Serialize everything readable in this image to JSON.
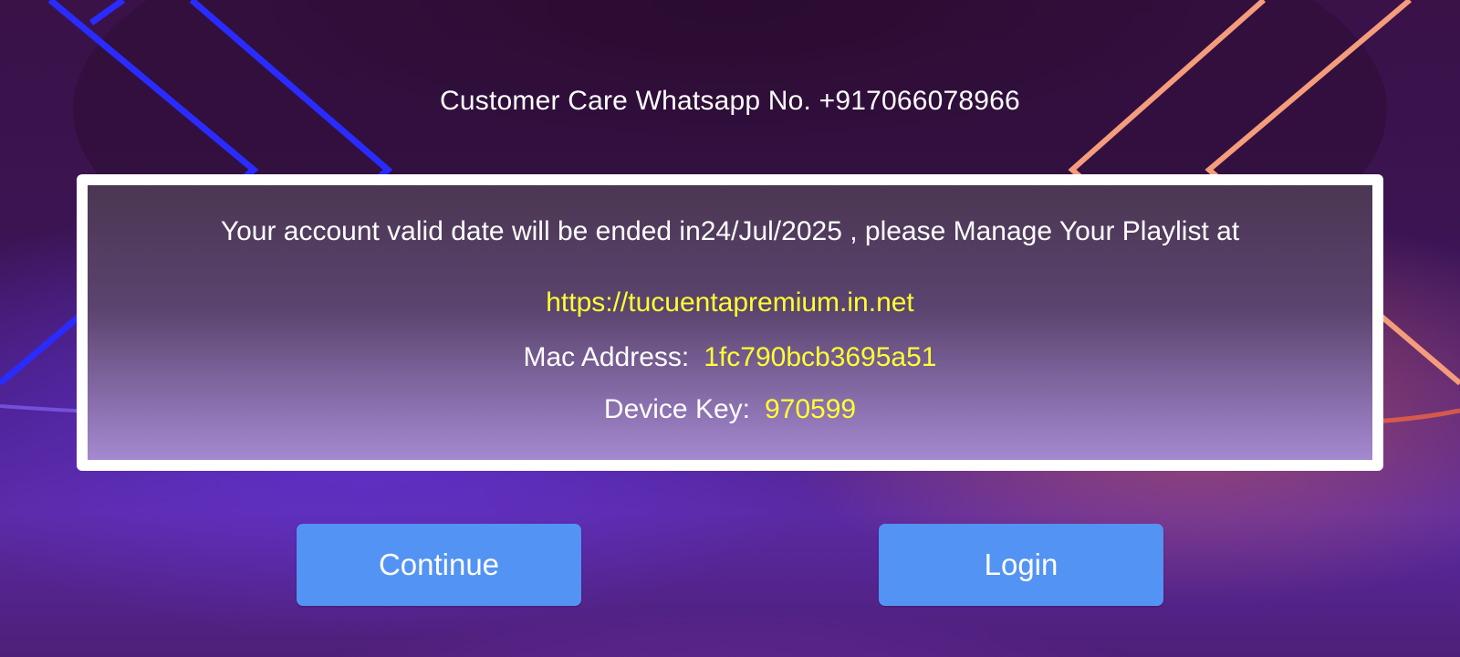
{
  "customer_care": {
    "text": "Customer Care Whatsapp No. +917066078966"
  },
  "account_panel": {
    "message": "Your account valid date will be ended in24/Jul/2025 , please Manage Your Playlist at",
    "url": "https://tucuentapremium.in.net",
    "mac_label": "Mac Address:",
    "mac_value": "1fc790bcb3695a51",
    "device_key_label": "Device Key:",
    "device_key_value": "970599"
  },
  "buttons": {
    "continue_label": "Continue",
    "login_label": "Login"
  },
  "colors": {
    "button_blue": "#5393f3",
    "highlight_yellow": "#ffff33",
    "frame_white": "#ffffff",
    "neon_blue": "#2b2bff",
    "neon_orange": "#f7a07f"
  }
}
